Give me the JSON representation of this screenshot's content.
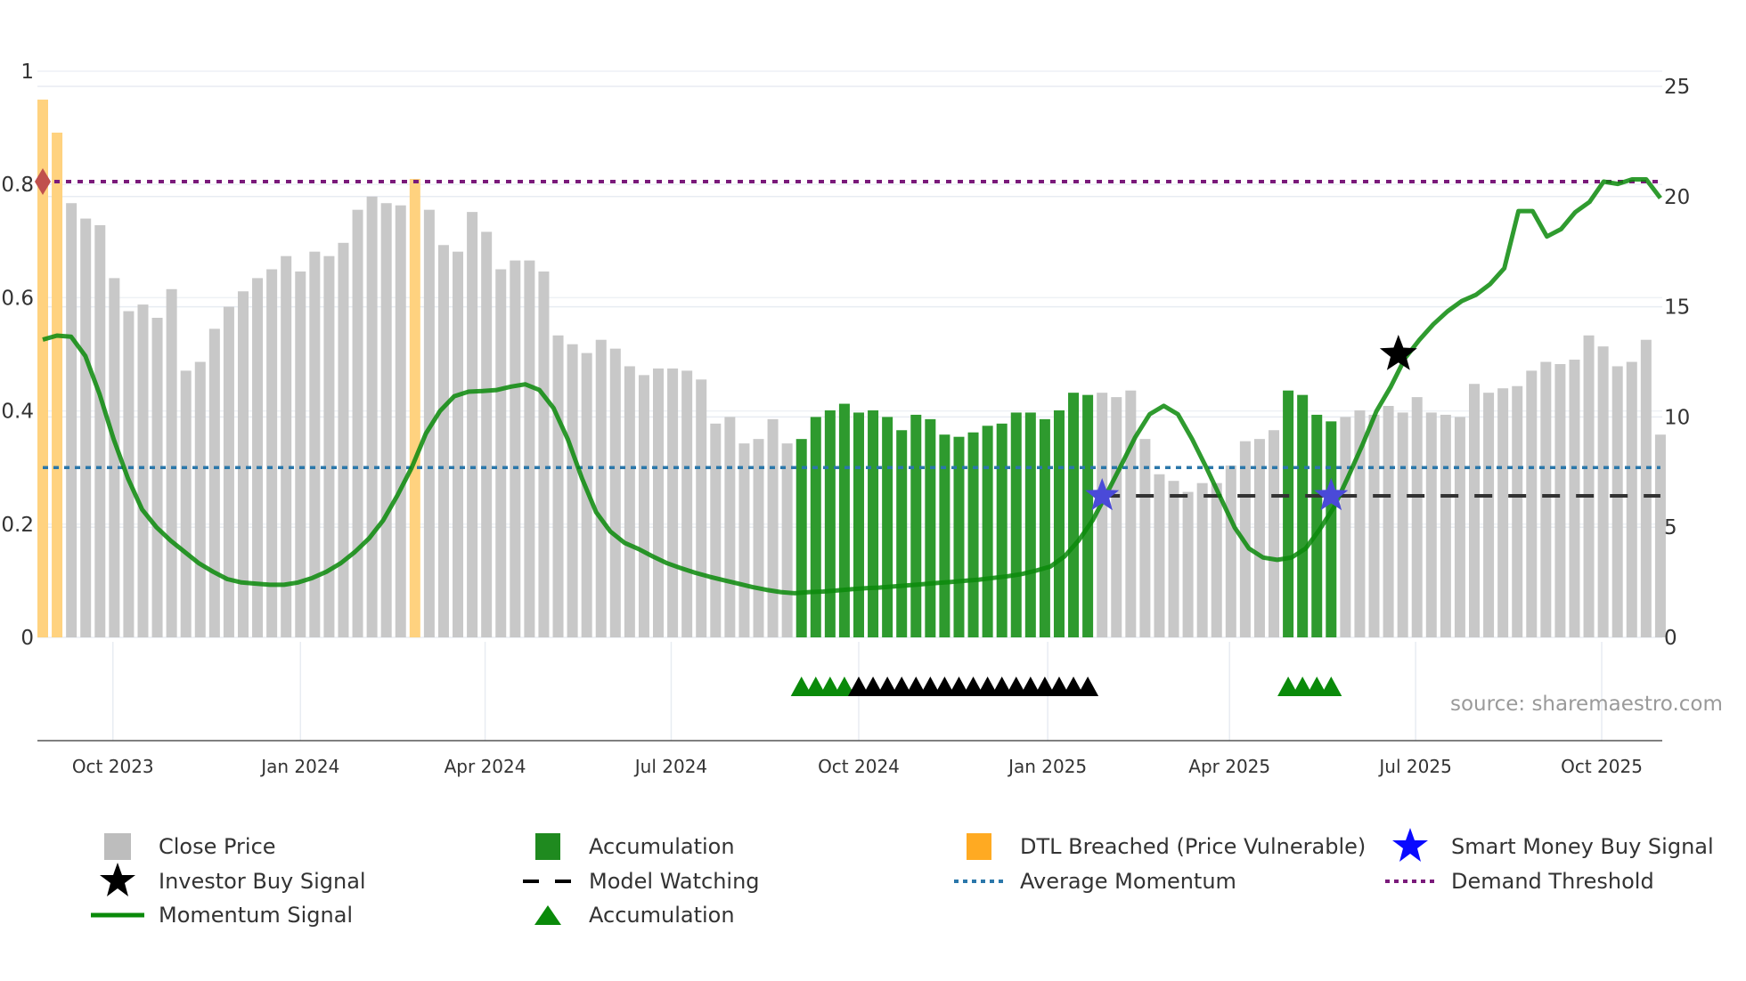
{
  "chart_data": {
    "type": "bar",
    "source_label": "source: sharemaestro.com",
    "left_axis": {
      "range": [
        0,
        1
      ],
      "ticks": [
        0,
        0.2,
        0.4,
        0.6,
        0.8,
        1
      ],
      "tick_labels": [
        "0",
        "0.2",
        "0.4",
        "0.6",
        "0.8",
        "1"
      ]
    },
    "right_axis": {
      "range": [
        0,
        25
      ],
      "ticks": [
        0,
        5,
        10,
        15,
        20,
        25
      ],
      "tick_labels": [
        "0",
        "5",
        "10",
        "15",
        "20",
        "25"
      ]
    },
    "x_axis": {
      "unit": "week index",
      "ticks": [
        4.9,
        18.0,
        30.9,
        43.9,
        57.0,
        70.2,
        82.9,
        95.9,
        108.9
      ],
      "tick_labels": [
        "Oct 2023",
        "Jan 2024",
        "Apr 2024",
        "Jul 2024",
        "Oct 2024",
        "Jan 2025",
        "Apr 2025",
        "Jul 2025",
        "Oct 2025"
      ]
    },
    "close_price": [
      24.4,
      22.9,
      19.7,
      19.0,
      18.7,
      16.3,
      14.8,
      15.1,
      14.5,
      15.8,
      12.1,
      12.5,
      14.0,
      15.0,
      15.7,
      16.3,
      16.7,
      17.3,
      16.6,
      17.5,
      17.3,
      17.9,
      19.4,
      20.0,
      19.7,
      19.6,
      20.8,
      19.4,
      17.8,
      17.5,
      19.3,
      18.4,
      16.7,
      17.1,
      17.1,
      16.6,
      13.7,
      13.3,
      12.9,
      13.5,
      13.1,
      12.3,
      11.9,
      12.2,
      12.2,
      12.1,
      11.7,
      9.7,
      10.0,
      8.8,
      9.0,
      9.9,
      8.8,
      9.0,
      10.0,
      10.3,
      10.6,
      10.2,
      10.3,
      10.0,
      9.4,
      10.1,
      9.9,
      9.2,
      9.1,
      9.3,
      9.6,
      9.7,
      10.2,
      10.2,
      9.9,
      10.3,
      11.1,
      11.0,
      11.1,
      10.9,
      11.2,
      9.0,
      7.4,
      7.1,
      6.6,
      7.0,
      7.0,
      7.8,
      8.9,
      9.0,
      9.4,
      11.2,
      11.0,
      10.1,
      9.8,
      10.0,
      10.3,
      10.1,
      10.5,
      10.2,
      10.9,
      10.2,
      10.1,
      10.0,
      11.5,
      11.1,
      11.3,
      11.4,
      12.1,
      12.5,
      12.4,
      12.6,
      13.7,
      13.2,
      12.3,
      12.5,
      13.5,
      9.2
    ],
    "accumulation_bars": [
      [
        53,
        73
      ],
      [
        87,
        90
      ]
    ],
    "dtl_breached_bars": [
      0,
      1,
      26
    ],
    "momentum_signal": [
      0.526,
      0.533,
      0.531,
      0.497,
      0.43,
      0.35,
      0.281,
      0.226,
      0.195,
      0.171,
      0.151,
      0.131,
      0.116,
      0.103,
      0.097,
      0.095,
      0.093,
      0.093,
      0.097,
      0.105,
      0.116,
      0.131,
      0.151,
      0.175,
      0.207,
      0.251,
      0.3,
      0.36,
      0.4,
      0.426,
      0.434,
      0.435,
      0.437,
      0.443,
      0.447,
      0.437,
      0.405,
      0.35,
      0.281,
      0.221,
      0.187,
      0.167,
      0.156,
      0.143,
      0.131,
      0.122,
      0.114,
      0.107,
      0.101,
      0.095,
      0.089,
      0.084,
      0.08,
      0.078,
      0.08,
      0.081,
      0.083,
      0.085,
      0.087,
      0.088,
      0.09,
      0.092,
      0.094,
      0.096,
      0.098,
      0.1,
      0.102,
      0.105,
      0.108,
      0.112,
      0.118,
      0.125,
      0.143,
      0.171,
      0.207,
      0.255,
      0.304,
      0.354,
      0.394,
      0.409,
      0.394,
      0.35,
      0.3,
      0.247,
      0.194,
      0.157,
      0.141,
      0.137,
      0.141,
      0.157,
      0.191,
      0.23,
      0.284,
      0.34,
      0.4,
      0.443,
      0.493,
      0.525,
      0.553,
      0.576,
      0.594,
      0.605,
      0.624,
      0.652,
      0.753,
      0.753,
      0.708,
      0.721,
      0.751,
      0.769,
      0.805,
      0.801,
      0.809,
      0.809,
      0.776
    ],
    "average_momentum": 0.3,
    "demand_threshold": 0.805,
    "model_watching": {
      "value": 0.25,
      "from": 74,
      "to": 113
    },
    "smart_money_buy_signals": [
      74,
      90
    ],
    "investor_buy_signals": [
      {
        "x": 94.7,
        "value": 0.5
      }
    ],
    "dtl_marker": {
      "x": 0,
      "value": 0.805
    },
    "accumulation_triangles": [
      53,
      54,
      55,
      56,
      87,
      88,
      89,
      90
    ],
    "black_triangles": [
      57,
      58,
      59,
      60,
      61,
      62,
      63,
      64,
      65,
      66,
      67,
      68,
      69,
      70,
      71,
      72,
      73
    ],
    "colors": {
      "close": "#c8c8c8",
      "accum": "#2e9a2e",
      "dtl": "#ffd27f",
      "momentum": "#0a8a0a",
      "avg": "#2b77aa",
      "threshold": "#7a1a7a",
      "smart": "#1a1aff",
      "investor": "#000000"
    }
  },
  "legend": [
    {
      "label": "Close Price"
    },
    {
      "label": "Accumulation"
    },
    {
      "label": "DTL Breached (Price Vulnerable)"
    },
    {
      "label": "Smart Money Buy Signal"
    },
    {
      "label": "Investor Buy Signal"
    },
    {
      "label": "Model Watching"
    },
    {
      "label": "Average Momentum"
    },
    {
      "label": "Demand Threshold"
    },
    {
      "label": "Momentum Signal"
    },
    {
      "label": "Accumulation"
    }
  ]
}
